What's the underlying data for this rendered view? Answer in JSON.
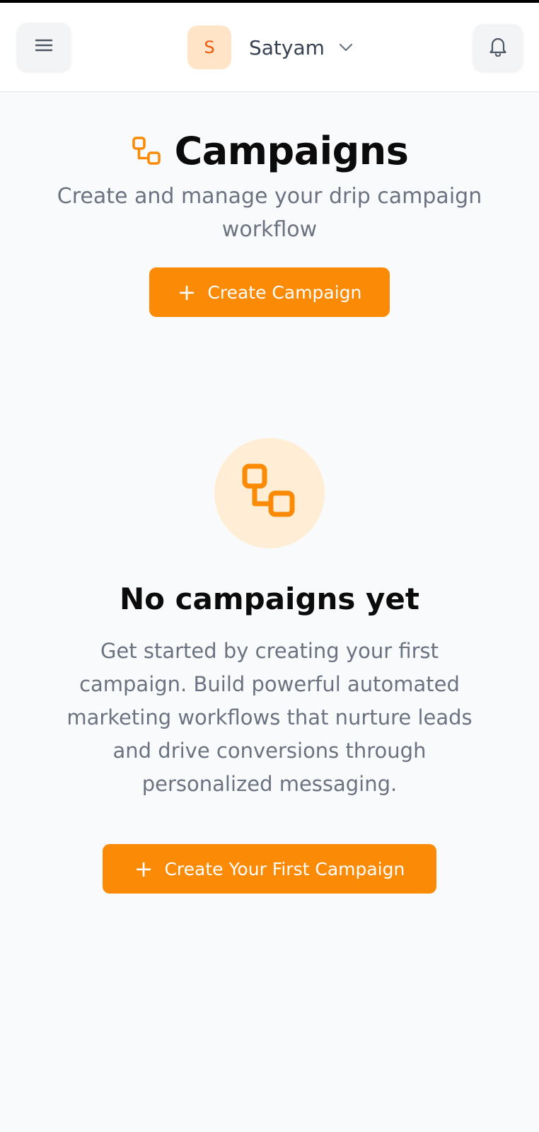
{
  "header": {
    "user": {
      "initial": "S",
      "name": "Satyam"
    },
    "icons": {
      "menu": "hamburger-menu-icon",
      "dropdown": "chevron-down-icon",
      "notifications": "bell-icon"
    }
  },
  "page": {
    "title": "Campaigns",
    "title_icon": "workflow-icon",
    "subtitle": "Create and manage your drip campaign workflow",
    "create_button": {
      "icon": "+",
      "label": "Create Campaign"
    }
  },
  "empty_state": {
    "icon": "workflow-icon",
    "title": "No campaigns yet",
    "description": "Get started by creating your first campaign. Build powerful automated marketing workflows that nurture leads and drive conversions through personalized messaging.",
    "button": {
      "icon": "+",
      "label": "Create Your First Campaign"
    }
  },
  "colors": {
    "accent": "#fb8a06",
    "accent_soft": "#ffedd5",
    "avatar_bg": "#ffe4c7",
    "avatar_text": "#ea580c",
    "muted_text": "#6b7280",
    "background": "#f9fafb"
  }
}
